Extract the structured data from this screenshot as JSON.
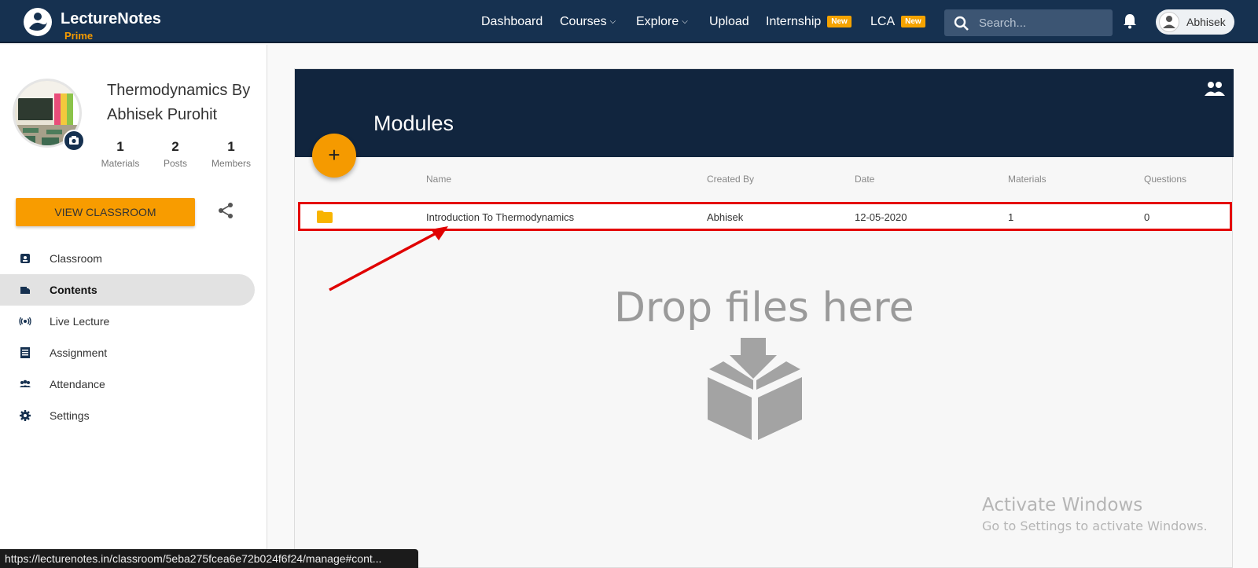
{
  "nav": {
    "brand": "LectureNotes",
    "brand_sub": "Prime",
    "items": [
      {
        "label": "Dashboard"
      },
      {
        "label": "Courses"
      },
      {
        "label": "Explore"
      },
      {
        "label": "Upload"
      },
      {
        "label": "Internship",
        "badge": "New"
      },
      {
        "label": "LCA",
        "badge": "New"
      }
    ],
    "search_placeholder": "Search...",
    "user_name": "Abhisek"
  },
  "sidebar": {
    "class_title": "Thermodynamics By Abhisek Purohit",
    "stats": [
      {
        "value": "1",
        "label": "Materials"
      },
      {
        "value": "2",
        "label": "Posts"
      },
      {
        "value": "1",
        "label": "Members"
      }
    ],
    "view_button": "VIEW CLASSROOM",
    "menu": [
      {
        "label": "Classroom",
        "icon": "classroom-icon"
      },
      {
        "label": "Contents",
        "icon": "contents-icon",
        "active": true
      },
      {
        "label": "Live Lecture",
        "icon": "live-icon"
      },
      {
        "label": "Assignment",
        "icon": "assignment-icon"
      },
      {
        "label": "Attendance",
        "icon": "attendance-icon"
      },
      {
        "label": "Settings",
        "icon": "settings-icon"
      }
    ]
  },
  "modules": {
    "title": "Modules",
    "fab": "+",
    "columns": [
      "Name",
      "Created By",
      "Date",
      "Materials",
      "Questions"
    ],
    "rows": [
      {
        "name": "Introduction To Thermodynamics",
        "created_by": "Abhisek",
        "date": "12-05-2020",
        "materials": "1",
        "questions": "0"
      }
    ],
    "drop_text": "Drop files here"
  },
  "watermark": {
    "line1": "Activate Windows",
    "line2": "Go to Settings to activate Windows."
  },
  "status_url": "https://lecturenotes.in/classroom/5eba275fcea6e72b024f6f24/manage#cont...",
  "colors": {
    "nav_bg": "#163150",
    "accent": "#f89c00",
    "highlight": "#e40000"
  }
}
